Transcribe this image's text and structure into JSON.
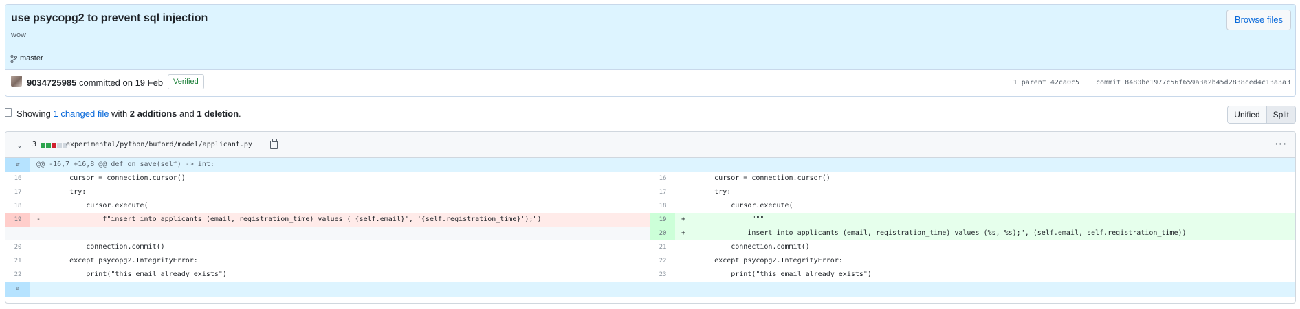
{
  "commit": {
    "title": "use psycopg2 to prevent sql injection",
    "description": "wow",
    "browse_label": "Browse files",
    "branch": "master",
    "author": "9034725985",
    "action": "committed on 19 Feb",
    "verified": "Verified",
    "parent_label": "1 parent 42ca0c5",
    "commit_label": "commit 8480be1977c56f659a3a2b45d2838ced4c13a3a3"
  },
  "summary": {
    "prefix": "Showing ",
    "changed": "1 changed file",
    "mid": " with ",
    "additions": "2 additions",
    "and": " and ",
    "deletions": "1 deletion",
    "suffix": "."
  },
  "view_toggle": {
    "unified": "Unified",
    "split": "Split",
    "active": "Split"
  },
  "file": {
    "change_count": "3",
    "diffstat": [
      "g",
      "g",
      "r",
      "n",
      "n"
    ],
    "path": "experimental/python/buford/model/applicant.py",
    "hunk_header": "@@ -16,7 +16,8 @@ def on_save(self) -> int:",
    "rows": [
      {
        "left": {
          "ln": "16",
          "text": "        cursor = connection.cursor()",
          "type": "ctx"
        },
        "right": {
          "ln": "16",
          "text": "        cursor = connection.cursor()",
          "type": "ctx"
        }
      },
      {
        "left": {
          "ln": "17",
          "text": "        try:",
          "type": "ctx"
        },
        "right": {
          "ln": "17",
          "text": "        try:",
          "type": "ctx"
        }
      },
      {
        "left": {
          "ln": "18",
          "text": "            cursor.execute(",
          "type": "ctx"
        },
        "right": {
          "ln": "18",
          "text": "            cursor.execute(",
          "type": "ctx"
        }
      },
      {
        "left": {
          "ln": "19",
          "text": "-               f\"insert into applicants (email, registration_time) values ('{self.email}', '{self.registration_time}');\")",
          "type": "del"
        },
        "right": {
          "ln": "19",
          "text": "+                \"\"\"",
          "type": "add"
        }
      },
      {
        "left": {
          "ln": "",
          "text": "",
          "type": "empty"
        },
        "right": {
          "ln": "20",
          "text": "+               insert into applicants (email, registration_time) values (%s, %s);\", (self.email, self.registration_time))",
          "type": "add"
        }
      },
      {
        "left": {
          "ln": "20",
          "text": "            connection.commit()",
          "type": "ctx"
        },
        "right": {
          "ln": "21",
          "text": "            connection.commit()",
          "type": "ctx"
        }
      },
      {
        "left": {
          "ln": "21",
          "text": "        except psycopg2.IntegrityError:",
          "type": "ctx"
        },
        "right": {
          "ln": "22",
          "text": "        except psycopg2.IntegrityError:",
          "type": "ctx"
        }
      },
      {
        "left": {
          "ln": "22",
          "text": "            print(\"this email already exists\")",
          "type": "ctx"
        },
        "right": {
          "ln": "23",
          "text": "            print(\"this email already exists\")",
          "type": "ctx"
        }
      }
    ]
  },
  "icons": {
    "branch": "git-branch-icon",
    "file": "file-diff-icon",
    "chevron": "chevron-down-icon",
    "copy": "copy-icon",
    "kebab": "kebab-horizontal-icon",
    "expand": "unfold-icon"
  },
  "colors": {
    "accent": "#0969da",
    "header_bg": "#ddf4ff",
    "deletion_bg": "#ffebe9",
    "addition_bg": "#e6ffec",
    "verified": "#1a7f37"
  }
}
